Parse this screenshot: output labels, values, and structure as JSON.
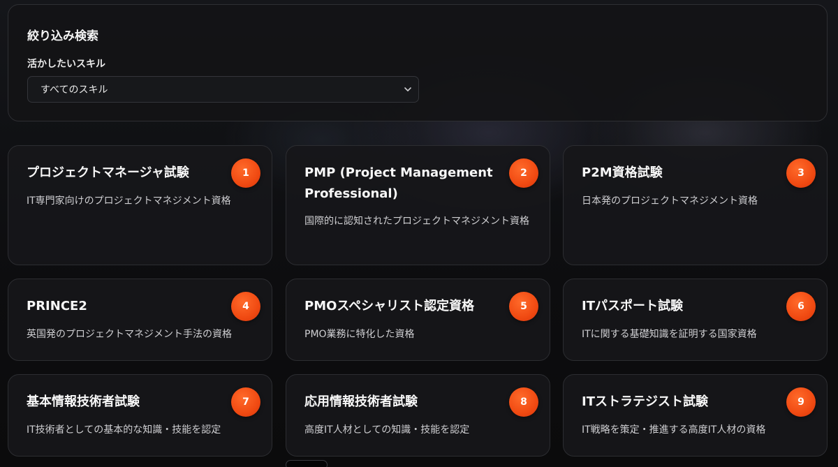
{
  "filter": {
    "title": "絞り込み検索",
    "skill_label": "活かしたいスキル",
    "skill_selected": "すべてのスキル"
  },
  "cards": [
    {
      "rank": "1",
      "title": "プロジェクトマネージャ試験",
      "desc": "IT専門家向けのプロジェクトマネジメント資格"
    },
    {
      "rank": "2",
      "title": "PMP (Project Management Professional)",
      "desc": "国際的に認知されたプロジェクトマネジメント資格"
    },
    {
      "rank": "3",
      "title": "P2M資格試験",
      "desc": "日本発のプロジェクトマネジメント資格"
    },
    {
      "rank": "4",
      "title": "PRINCE2",
      "desc": "英国発のプロジェクトマネジメント手法の資格"
    },
    {
      "rank": "5",
      "title": "PMOスペシャリスト認定資格",
      "desc": "PMO業務に特化した資格"
    },
    {
      "rank": "6",
      "title": "ITパスポート試験",
      "desc": "ITに関する基礎知識を証明する国家資格"
    },
    {
      "rank": "7",
      "title": "基本情報技術者試験",
      "desc": "IT技術者としての基本的な知識・技能を認定"
    },
    {
      "rank": "8",
      "title": "応用情報技術者試験",
      "desc": "高度IT人材としての知識・技能を認定"
    },
    {
      "rank": "9",
      "title": "ITストラテジスト試験",
      "desc": "IT戦略を策定・推進する高度IT人材の資格"
    }
  ],
  "colors": {
    "badge": "#f04a12",
    "background": "#0d0d0f",
    "card": "#161619"
  }
}
